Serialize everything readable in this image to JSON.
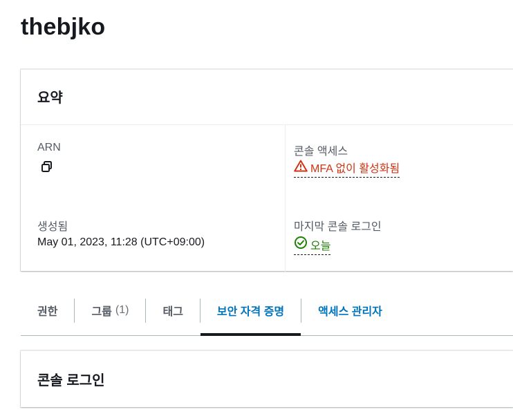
{
  "user_name": "thebjko",
  "summary": {
    "title": "요약",
    "arn_label": "ARN",
    "arn_value": "",
    "created_label": "생성됨",
    "created_value": "May 01, 2023, 11:28 (UTC+09:00)",
    "console_access_label": "콘솔 액세스",
    "console_access_value": "MFA 없이 활성화됨",
    "last_login_label": "마지막 콘솔 로그인",
    "last_login_value": "오늘"
  },
  "tabs": [
    {
      "label": "권한",
      "count": ""
    },
    {
      "label": "그룹",
      "count": "(1)"
    },
    {
      "label": "태그",
      "count": ""
    },
    {
      "label": "보안 자격 증명",
      "count": ""
    },
    {
      "label": "액세스 관리자",
      "count": ""
    }
  ],
  "active_tab": "보안 자격 증명",
  "console_login": {
    "title": "콘솔 로그인"
  },
  "colors": {
    "warning": "#d13212",
    "success": "#1d8102",
    "link": "#0073bb"
  },
  "icons": {
    "copy": "copy-icon",
    "warning": "warning-icon",
    "success": "check-circle-icon"
  }
}
